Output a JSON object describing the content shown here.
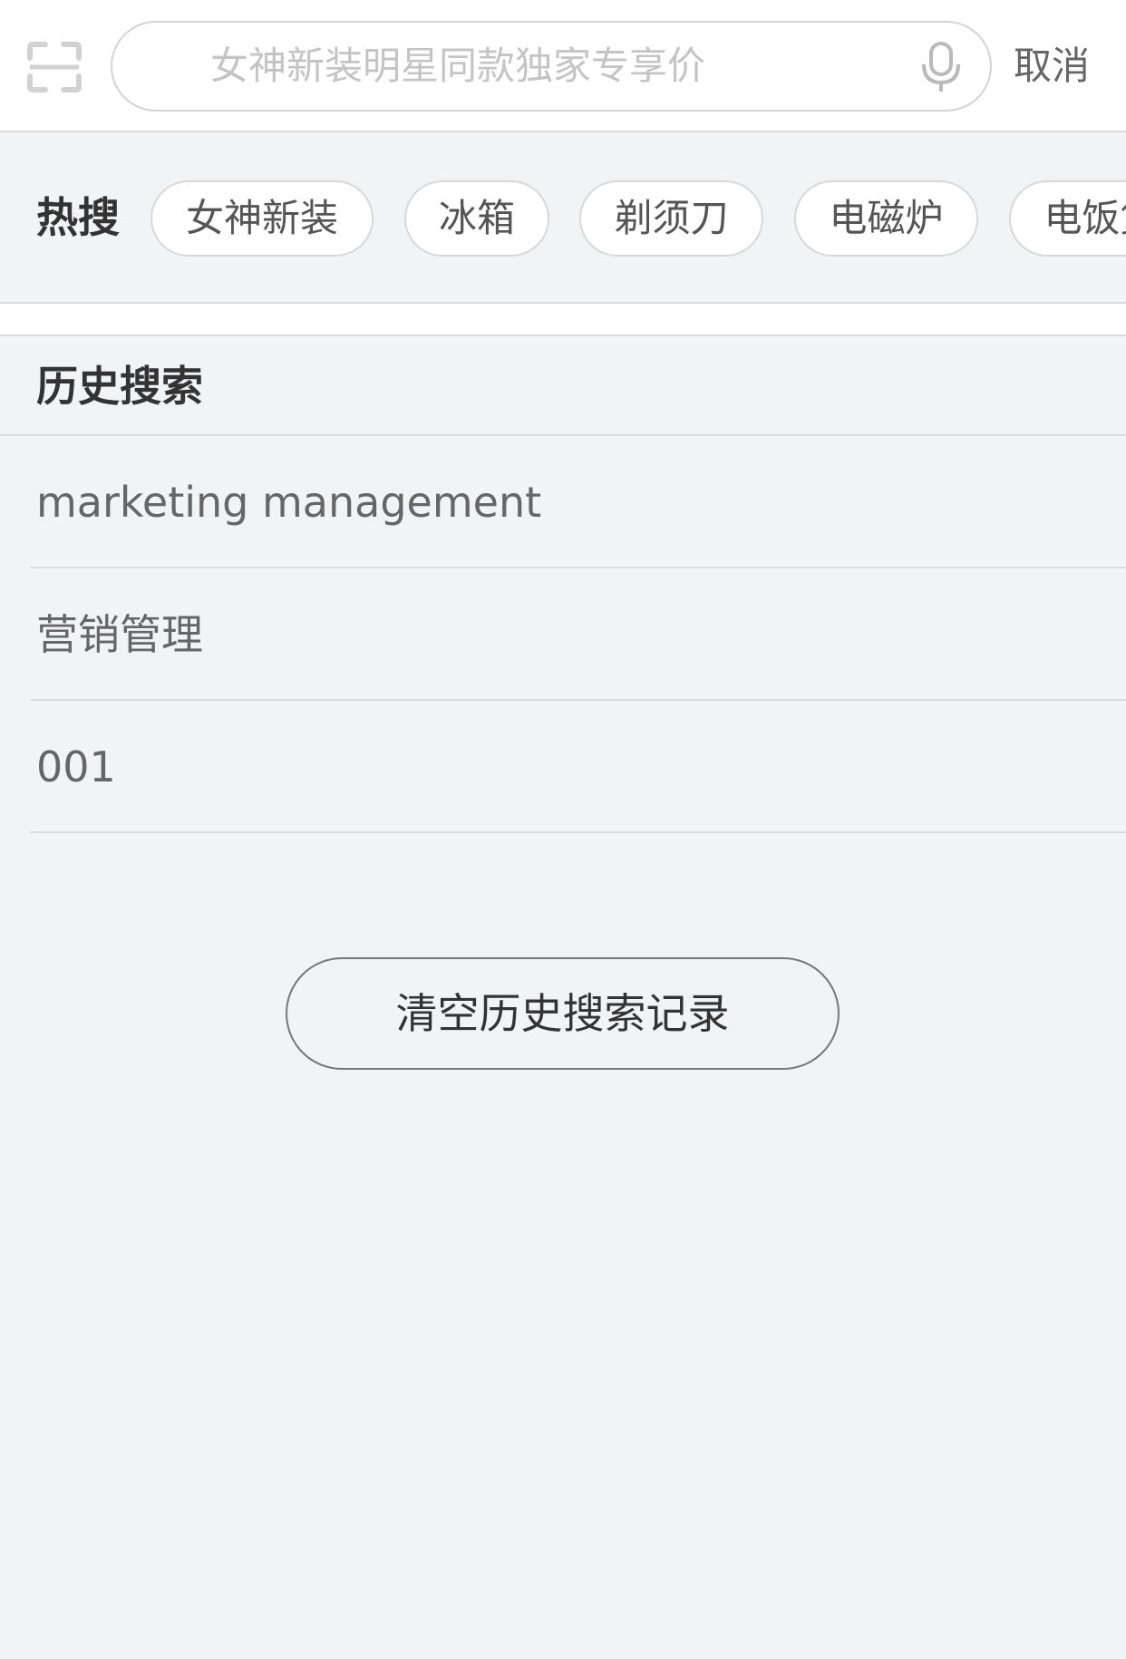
{
  "search": {
    "placeholder": "女神新装明星同款独家专享价",
    "cancel_label": "取消",
    "scan_icon": "scan-icon",
    "mic_icon": "microphone-icon"
  },
  "hot": {
    "label": "热搜",
    "chips": [
      "女神新装",
      "冰箱",
      "剃须刀",
      "电磁炉",
      "电饭煲"
    ]
  },
  "history": {
    "title": "历史搜索",
    "items": [
      "marketing management",
      "营销管理",
      "001"
    ],
    "clear_label": "清空历史搜索记录"
  }
}
